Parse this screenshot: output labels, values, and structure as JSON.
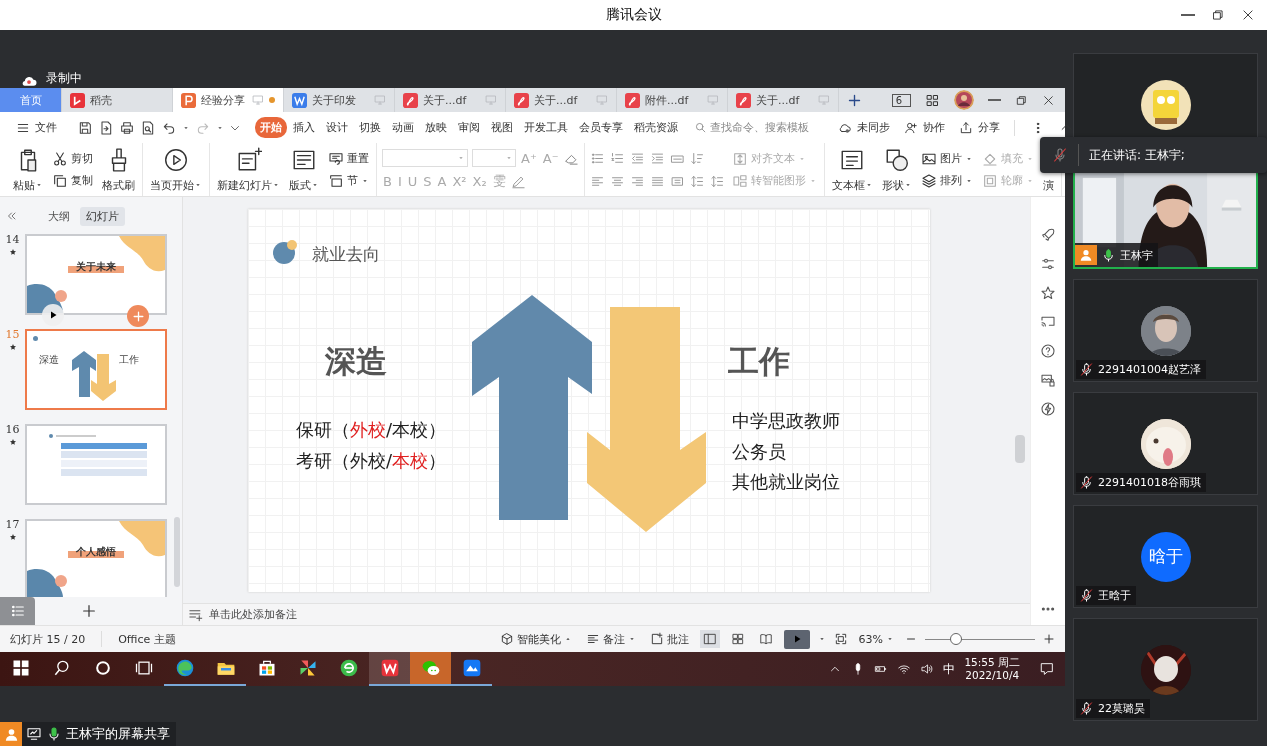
{
  "window": {
    "title": "腾讯会议"
  },
  "recording": {
    "label": "录制中"
  },
  "wps": {
    "tabs": [
      {
        "kind": "home",
        "label": "首页",
        "selected": false
      },
      {
        "kind": "docer",
        "label": "稻壳",
        "selected": false
      },
      {
        "kind": "slides",
        "label": "经验分享",
        "selected": true,
        "unsaved": true
      },
      {
        "kind": "doc",
        "label": "关于印发",
        "selected": false
      },
      {
        "kind": "pdf",
        "label": "关于...df",
        "selected": false
      },
      {
        "kind": "pdf",
        "label": "关于...df",
        "selected": false
      },
      {
        "kind": "pdf",
        "label": "附件...df",
        "selected": false
      },
      {
        "kind": "pdf",
        "label": "关于...df",
        "selected": false
      }
    ],
    "tab_count": "6",
    "menu": {
      "file": "文件",
      "tabs": [
        {
          "label": "开始",
          "selected": true
        },
        {
          "label": "插入",
          "selected": false
        },
        {
          "label": "设计",
          "selected": false
        },
        {
          "label": "切换",
          "selected": false
        },
        {
          "label": "动画",
          "selected": false
        },
        {
          "label": "放映",
          "selected": false
        },
        {
          "label": "审阅",
          "selected": false
        },
        {
          "label": "视图",
          "selected": false
        },
        {
          "label": "开发工具",
          "selected": false
        },
        {
          "label": "会员专享",
          "selected": false
        },
        {
          "label": "稻壳资源",
          "selected": false
        }
      ],
      "search": {
        "placeholder": "查找命令、搜索模板"
      },
      "actions": [
        {
          "kind": "sync",
          "label": "未同步"
        },
        {
          "kind": "collab",
          "label": "协作"
        },
        {
          "kind": "share",
          "label": "分享"
        }
      ]
    },
    "ribbon": [
      {
        "kind": "buttons",
        "columns": [
          [
            {
              "kind": "paste",
              "label": "粘贴",
              "dropdown": true
            }
          ],
          [
            {
              "kind": "cut",
              "label": "剪切",
              "dropdown": false
            },
            {
              "kind": "copy",
              "label": "复制",
              "dropdown": false
            }
          ],
          [
            {
              "kind": "brush",
              "label": "格式刷",
              "dropdown": false
            }
          ]
        ]
      },
      {
        "kind": "buttons",
        "columns": [
          [
            {
              "kind": "play",
              "label": "当页开始",
              "dropdown": true
            }
          ]
        ]
      },
      {
        "kind": "buttons",
        "columns": [
          [
            {
              "kind": "new-slide",
              "label": "新建幻灯片",
              "dropdown": true
            }
          ],
          [
            {
              "kind": "layout",
              "label": "版式",
              "dropdown": true
            }
          ],
          [
            {
              "kind": "reset",
              "label": "重置",
              "dropdown": false
            },
            {
              "kind": "section",
              "label": "节",
              "dropdown": true
            }
          ]
        ]
      },
      {
        "kind": "font",
        "disabled": true,
        "top_marks": [
          "A⁺",
          "A⁻"
        ],
        "marks": [
          "B",
          "I",
          "U",
          "S",
          "A",
          "X²",
          "X₂",
          "雯"
        ]
      },
      {
        "kind": "paragraph",
        "columns": [
          [
            {
              "kind": "align-text",
              "label": "对齐文本",
              "dropdown": true,
              "disabled": true
            },
            {
              "kind": "smart-art",
              "label": "转智能图形",
              "dropdown": true,
              "disabled": true
            }
          ]
        ]
      },
      {
        "kind": "buttons",
        "columns": [
          [
            {
              "kind": "textbox",
              "label": "文本框",
              "dropdown": true
            }
          ],
          [
            {
              "kind": "shape",
              "label": "形状",
              "dropdown": true
            }
          ],
          [
            {
              "kind": "picture",
              "label": "图片",
              "dropdown": true
            },
            {
              "kind": "arrange",
              "label": "排列",
              "dropdown": true
            }
          ],
          [
            {
              "kind": "fill",
              "label": "填充",
              "dropdown": true,
              "disabled": true
            },
            {
              "kind": "outline",
              "label": "轮廓",
              "dropdown": true,
              "disabled": true
            }
          ],
          [
            {
              "kind": "present",
              "label": "演",
              "dropdown": false
            }
          ]
        ]
      }
    ],
    "panel": {
      "tabs": [
        {
          "label": "大纲",
          "selected": false
        },
        {
          "label": "幻灯片",
          "selected": true
        }
      ],
      "slides": [
        {
          "number": "14",
          "kind": "section",
          "title": "关于未来",
          "selected": false,
          "hovered": true
        },
        {
          "number": "15",
          "kind": "arrows",
          "texts": [
            "深造",
            "工作"
          ],
          "selected": true,
          "hovered": false
        },
        {
          "number": "16",
          "kind": "table",
          "selected": false,
          "hovered": false
        },
        {
          "number": "17",
          "kind": "section",
          "title": "个人感悟",
          "selected": false,
          "hovered": false
        }
      ]
    },
    "slide": {
      "heading": "就业去向",
      "left": {
        "title": "深造",
        "items": [
          [
            {
              "text": "保研（",
              "highlight": false
            },
            {
              "text": "外校",
              "highlight": true
            },
            {
              "text": "/本校）",
              "highlight": false
            }
          ],
          [
            {
              "text": "考研（外校/",
              "highlight": false
            },
            {
              "text": "本校",
              "highlight": true
            },
            {
              "text": "）",
              "highlight": false
            }
          ]
        ]
      },
      "right": {
        "title": "工作",
        "items": [
          "中学思政教师",
          "公务员",
          "其他就业岗位"
        ]
      }
    },
    "notes": {
      "placeholder": "单击此处添加备注"
    },
    "status": {
      "slide_info": "幻灯片 15 / 20",
      "theme": "Office 主题",
      "beautify": "智能美化",
      "notes": "备注",
      "comment": "批注",
      "views": [
        {
          "kind": "normal",
          "selected": true
        },
        {
          "kind": "sorter",
          "selected": false
        },
        {
          "kind": "reading",
          "selected": false
        }
      ],
      "zoom": "63%",
      "zoom_slider": {
        "level": 0.28
      }
    }
  },
  "taskbar": {
    "apps": [
      {
        "kind": "start",
        "running": false
      },
      {
        "kind": "search",
        "running": false
      },
      {
        "kind": "cortana",
        "running": false
      },
      {
        "kind": "taskview",
        "running": false
      },
      {
        "kind": "edge",
        "running": true
      },
      {
        "kind": "explorer",
        "running": true
      },
      {
        "kind": "store",
        "running": false
      },
      {
        "kind": "pinwheel",
        "running": false
      },
      {
        "kind": "globe",
        "running": false
      },
      {
        "kind": "wps",
        "running": true,
        "selected": true
      },
      {
        "kind": "chat",
        "running": true,
        "attention": true
      },
      {
        "kind": "meeting",
        "running": true
      }
    ],
    "ime": "中",
    "time": "15:55 周二",
    "date": "2022/10/4"
  },
  "share": {
    "label": "王林宇的屏幕共享"
  },
  "speaking": {
    "label": "正在讲话: 王林宇;"
  },
  "participants": [
    {
      "kind": "picture",
      "speaking": false
    },
    {
      "kind": "video",
      "name": "王林宇",
      "host": true,
      "muted": false,
      "speaking": true
    },
    {
      "kind": "picture",
      "name": "2291401004赵艺泽",
      "host": false,
      "muted": true,
      "speaking": false
    },
    {
      "kind": "picture",
      "name": "2291401018谷雨琪",
      "host": false,
      "muted": true,
      "speaking": false
    },
    {
      "kind": "initials",
      "initials": "晗于",
      "name": "王晗于",
      "host": false,
      "muted": true,
      "speaking": false
    },
    {
      "kind": "picture",
      "name": "22莫璐昊",
      "host": false,
      "muted": true,
      "speaking": false
    }
  ]
}
